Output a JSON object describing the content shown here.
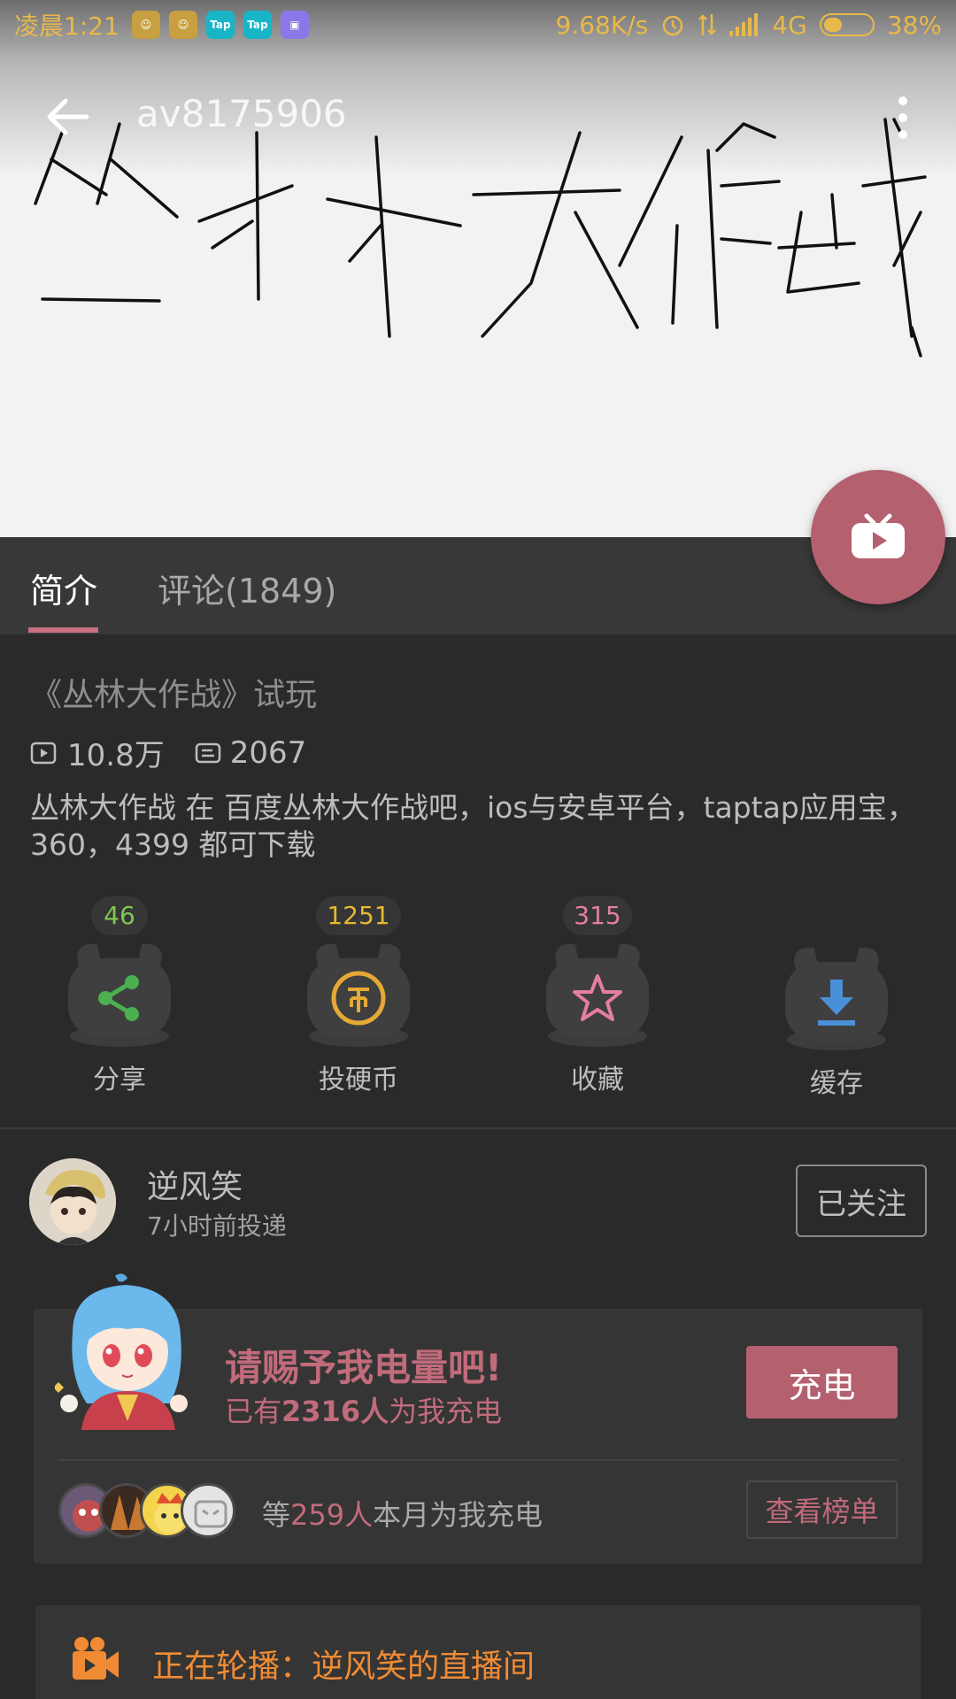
{
  "status_bar": {
    "time": "凌晨1:21",
    "app_icons": [
      "iron-man-icon",
      "iron-man-icon",
      "taptap-icon",
      "taptap-icon",
      "app-icon"
    ],
    "tap_label": "Tap",
    "net_speed": "9.68K/s",
    "network": "4G",
    "battery": "38%",
    "battery_level": 0.38,
    "accent": "#e8b84a"
  },
  "header": {
    "video_id": "av8175906",
    "cover_text": "丛林大作战"
  },
  "tabs": [
    {
      "label": "简介",
      "active": true
    },
    {
      "label": "评论(1849)",
      "active": false
    }
  ],
  "video": {
    "title": "《丛林大作战》试玩",
    "views": "10.8万",
    "danmaku": "2067",
    "description": "丛林大作战 在 百度丛林大作战吧，ios与安卓平台，taptap应用宝，360，4399 都可下载"
  },
  "actions": [
    {
      "count": "46",
      "label": "分享",
      "icon": "share-icon",
      "color": "#4caf50"
    },
    {
      "count": "1251",
      "label": "投硬币",
      "icon": "coin-icon",
      "color": "#e6a935"
    },
    {
      "count": "315",
      "label": "收藏",
      "icon": "star-icon",
      "color": "#e57ea0"
    },
    {
      "count": "",
      "label": "缓存",
      "icon": "download-icon",
      "color": "#4a90d9"
    }
  ],
  "uploader": {
    "name": "逆风笑",
    "time": "7小时前投递",
    "follow_label": "已关注"
  },
  "charge": {
    "title": "请赐予我电量吧!",
    "sub_prefix": "已有",
    "sub_count": "2316人",
    "sub_suffix": "为我充电",
    "button": "充电",
    "supporters_prefix": "等",
    "supporters_count": "259人",
    "supporters_suffix": "本月为我充电",
    "rank_button": "查看榜单"
  },
  "live": {
    "text": "正在轮播：逆风笑的直播间"
  },
  "colors": {
    "accent_pink": "#b4606f",
    "background": "#2a2a2a",
    "live_orange": "#f08b34"
  }
}
